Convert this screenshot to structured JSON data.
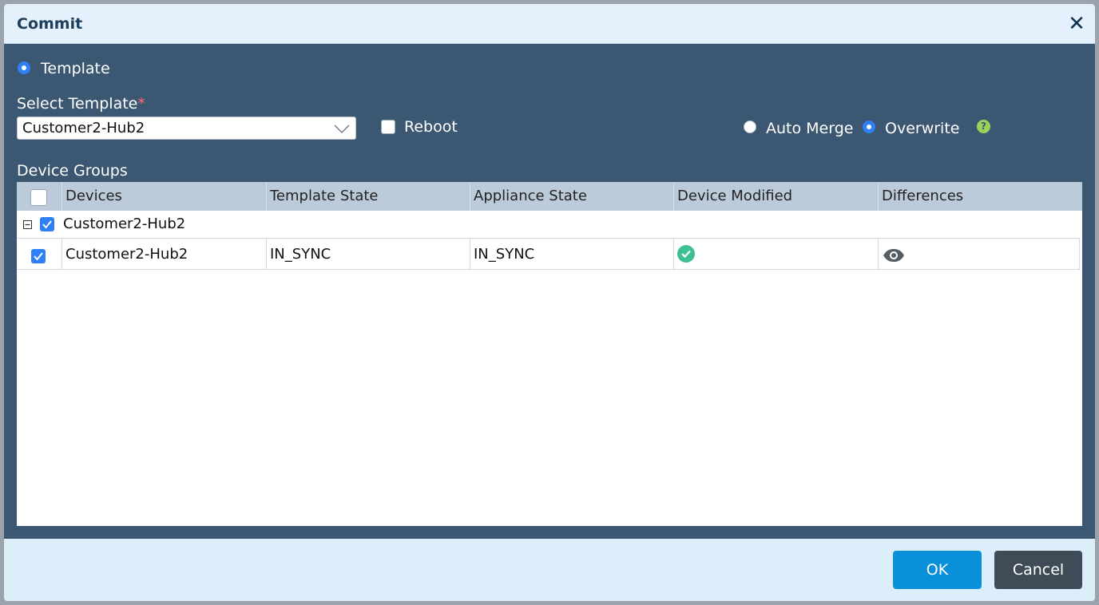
{
  "dialog": {
    "title": "Commit"
  },
  "mode": {
    "template_label": "Template"
  },
  "select_template": {
    "label": "Select Template",
    "required_mark": "*",
    "value": "Customer2-Hub2"
  },
  "reboot": {
    "label": "Reboot",
    "checked": false
  },
  "merge": {
    "auto_merge_label": "Auto Merge",
    "overwrite_label": "Overwrite",
    "selected": "Overwrite",
    "help_icon": "question-circle-icon"
  },
  "device_groups": {
    "label": "Device Groups",
    "columns": [
      "Devices",
      "Template State",
      "Appliance State",
      "Device Modified",
      "Differences"
    ],
    "group": {
      "name": "Customer2-Hub2",
      "expanded": true,
      "checked": true
    },
    "rows": [
      {
        "device": "Customer2-Hub2",
        "template_state": "IN_SYNC",
        "appliance_state": "IN_SYNC",
        "device_modified_icon": "check-circle-icon",
        "differences_icon": "eye-icon",
        "checked": true
      }
    ]
  },
  "footer": {
    "ok_label": "OK",
    "cancel_label": "Cancel"
  },
  "colors": {
    "dialog_body": "#3b5771",
    "title_bar": "#e4f0fb",
    "accent_blue": "#2f7ff5",
    "ok_button": "#0a8fdb",
    "cancel_button": "#3f4b56",
    "success_green": "#3fbf95",
    "help_green": "#9ed15a"
  }
}
